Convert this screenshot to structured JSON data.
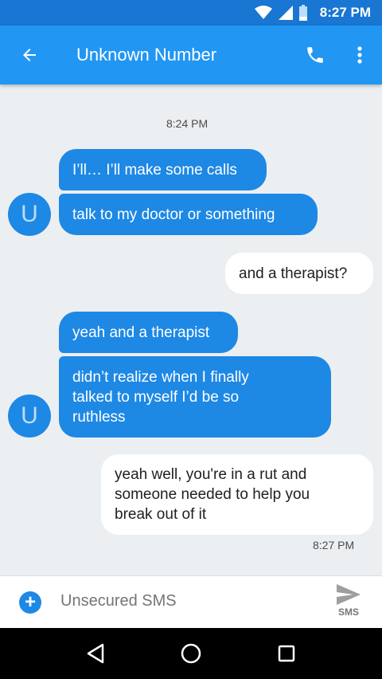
{
  "status_bar": {
    "time": "8:27 PM",
    "icons": [
      "wifi-icon",
      "cell-signal-icon",
      "battery-icon"
    ]
  },
  "header": {
    "title": "Unknown Number",
    "back_icon": "arrow-back-icon",
    "call_icon": "phone-icon",
    "menu_icon": "more-vert-icon"
  },
  "conversation": {
    "timestamp_top": "8:24 PM",
    "timestamp_bottom": "8:27 PM",
    "avatar_initial": "U",
    "messages": [
      {
        "direction": "incoming",
        "lines": [
          "I’ll… I’ll make some calls"
        ]
      },
      {
        "direction": "incoming",
        "lines": [
          "talk to my doctor or something"
        ]
      },
      {
        "direction": "outgoing",
        "lines": [
          "and a therapist?"
        ]
      },
      {
        "direction": "incoming",
        "lines": [
          "yeah and a therapist"
        ]
      },
      {
        "direction": "incoming",
        "lines": [
          "didn’t realize when I finally",
          "talked to myself I’d be so",
          "ruthless"
        ]
      },
      {
        "direction": "outgoing",
        "lines": [
          "yeah well, you're in a rut and",
          "someone needed to help you",
          "break out of it"
        ]
      }
    ]
  },
  "compose": {
    "placeholder": "Unsecured SMS",
    "add_icon": "add-circle-icon",
    "send_icon": "send-icon",
    "send_label": "SMS"
  },
  "nav_bar": {
    "icons": [
      "back-triangle-icon",
      "home-circle-icon",
      "recents-square-icon"
    ]
  },
  "colors": {
    "status_bar": "#1976d2",
    "app_bar": "#2196f3",
    "incoming_bubble": "#1e88e5",
    "outgoing_bubble": "#ffffff",
    "background": "#eceff1"
  }
}
